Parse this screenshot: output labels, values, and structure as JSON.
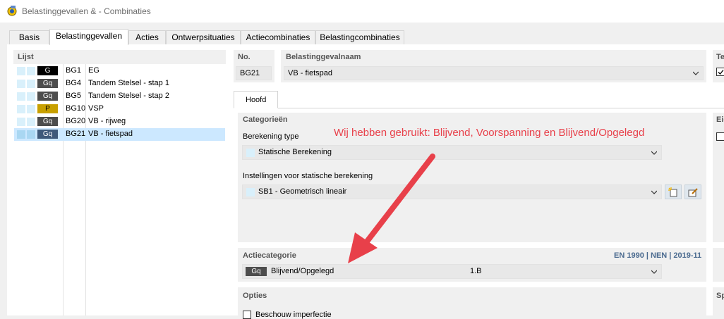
{
  "window": {
    "title": "Belastinggevallen & - Combinaties"
  },
  "tabs": [
    {
      "label": "Basis"
    },
    {
      "label": "Belastinggevallen"
    },
    {
      "label": "Acties"
    },
    {
      "label": "Ontwerpsituaties"
    },
    {
      "label": "Actiecombinaties"
    },
    {
      "label": "Belastingcombinaties"
    }
  ],
  "list": {
    "title": "Lijst",
    "rows": [
      {
        "badge": "G",
        "badge_color": "#000000",
        "no": "BG1",
        "name": "EG"
      },
      {
        "badge": "Gq",
        "badge_color": "#4d4d4d",
        "no": "BG4",
        "name": "Tandem Stelsel - stap 1"
      },
      {
        "badge": "Gq",
        "badge_color": "#4d4d4d",
        "no": "BG5",
        "name": "Tandem Stelsel - stap 2"
      },
      {
        "badge": "P",
        "badge_color": "#c8a000",
        "no": "BG10",
        "name": "VSP"
      },
      {
        "badge": "Gq",
        "badge_color": "#4d4d4d",
        "no": "BG20",
        "name": "VB - rijweg"
      },
      {
        "badge": "Gq",
        "badge_color": "#3f5a7a",
        "no": "BG21",
        "name": "VB - fietspad"
      }
    ]
  },
  "header": {
    "no_label": "No.",
    "no_value": "BG21",
    "name_label": "Belastinggevalnaam",
    "name_value": "VB - fietspad",
    "right_cut_label": "Te"
  },
  "subtab": {
    "label": "Hoofd"
  },
  "categories": {
    "title": "Categorieën",
    "calc_type_label": "Berekening type",
    "calc_type_value": "Statische Berekening",
    "static_settings_label": "Instellingen voor statische berekening",
    "static_settings_value": "SB1 - Geometrisch lineair"
  },
  "action_category": {
    "title": "Actiecategorie",
    "norm": "EN 1990 | NEN | 2019-11",
    "badge": "Gq",
    "value": "Blijvend/Opgelegd",
    "code": "1.B"
  },
  "options": {
    "title": "Opties",
    "checkbox_label": "Beschouw imperfectie"
  },
  "right_cut": {
    "eig": "Eig",
    "sp": "Sp"
  },
  "annotation": {
    "text": "Wij hebben gebruikt: Blijvend, Voorspanning en Blijvend/Opgelegd",
    "color": "#e8404a"
  }
}
